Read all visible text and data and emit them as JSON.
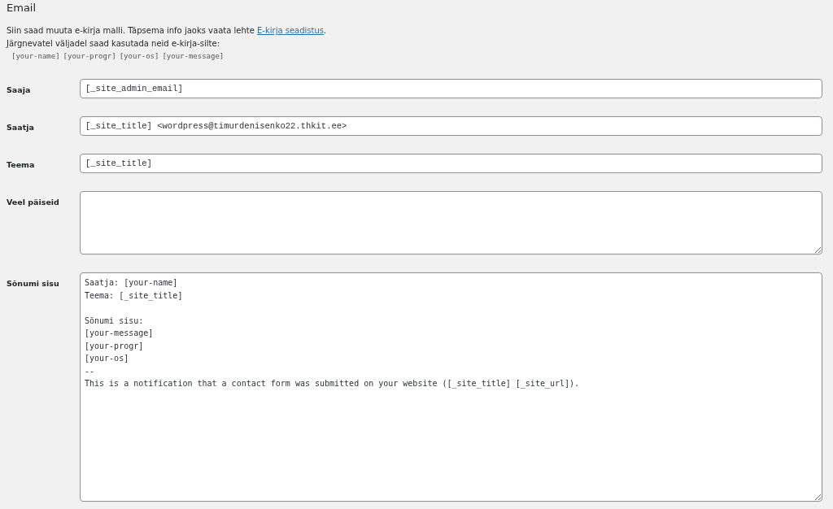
{
  "section_title": "Email",
  "description": "Siin saad muuta e-kirja malli. Täpsema info jaoks vaata lehte",
  "description_link": "E-kirja seadistus",
  "description_end": ".",
  "tags_intro": "Järgnevatel väljadel saad kasutada neid e-kirja-silte:",
  "tags": [
    "[your-name]",
    "[your-progr]",
    "[your-os]",
    "[your-message]"
  ],
  "fields": [
    {
      "label": "Saaja",
      "kind": "input",
      "value": "[_site_admin_email]"
    },
    {
      "label": "Saatja",
      "kind": "input",
      "value": "[_site_title] <wordpress@timurdenisenko22.thkit.ee>"
    },
    {
      "label": "Teema",
      "kind": "input",
      "value": "[_site_title]"
    },
    {
      "label": "Veel päiseid",
      "kind": "short_textarea"
    },
    {
      "label": "Sõnumi sisu",
      "kind": "textarea",
      "value": "Saatja: [your-name]\nTeema: [_site_title]\n\nSõnumi sisu:\n[your-message]\n[your-progr]\n[your-os]\n--\nThis is a notification that a contact form was submitted on your website ([_site_title] [_site_url])."
    }
  ]
}
